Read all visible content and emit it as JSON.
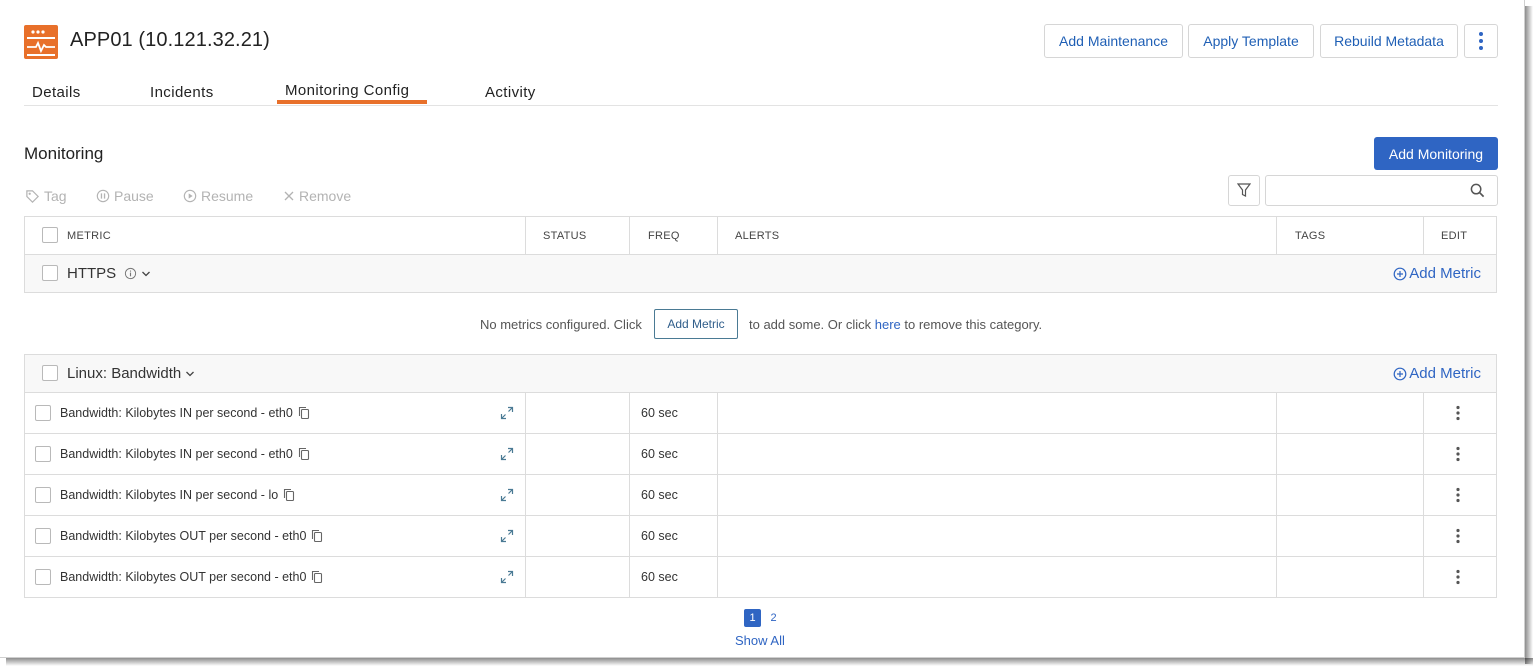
{
  "header": {
    "device_icon": "server-device-icon",
    "title": "APP01 (10.121.32.21)",
    "buttons": {
      "add_maintenance": "Add Maintenance",
      "apply_template": "Apply Template",
      "rebuild_metadata": "Rebuild Metadata",
      "more_icon": "kebab-menu-icon"
    }
  },
  "tabs": [
    {
      "label": "Details",
      "active": false
    },
    {
      "label": "Incidents",
      "active": false
    },
    {
      "label": "Monitoring Config",
      "active": true
    },
    {
      "label": "Activity",
      "active": false
    }
  ],
  "monitoring": {
    "title": "Monitoring",
    "add_button": "Add Monitoring",
    "toolbar": {
      "tag": "Tag",
      "pause": "Pause",
      "resume": "Resume",
      "remove": "Remove"
    },
    "search": {
      "value": "",
      "placeholder": ""
    },
    "columns": {
      "metric": "METRIC",
      "status": "STATUS",
      "freq": "FREQ",
      "alerts": "ALERTS",
      "tags": "TAGS",
      "edit": "EDIT"
    },
    "groups": [
      {
        "name": "HTTPS",
        "add_metric": "Add Metric",
        "empty": {
          "text_before": "No metrics configured. Click",
          "button": "Add Metric",
          "text_middle": "to add some. Or click",
          "link": "here",
          "text_after": "to remove this category."
        }
      },
      {
        "name": "Linux: Bandwidth",
        "add_metric": "Add Metric"
      }
    ],
    "rows": [
      {
        "metric": "Bandwidth: Kilobytes IN per second - eth0",
        "status": "",
        "freq": "60 sec",
        "alerts": "",
        "tags": ""
      },
      {
        "metric": "Bandwidth: Kilobytes IN per second - eth0",
        "status": "",
        "freq": "60 sec",
        "alerts": "",
        "tags": ""
      },
      {
        "metric": "Bandwidth: Kilobytes IN per second - lo",
        "status": "",
        "freq": "60 sec",
        "alerts": "",
        "tags": ""
      },
      {
        "metric": "Bandwidth: Kilobytes OUT per second - eth0",
        "status": "",
        "freq": "60 sec",
        "alerts": "",
        "tags": ""
      },
      {
        "metric": "Bandwidth: Kilobytes OUT per second - eth0",
        "status": "",
        "freq": "60 sec",
        "alerts": "",
        "tags": ""
      }
    ],
    "pagination": {
      "pages": [
        "1",
        "2"
      ],
      "current": "1",
      "show_all": "Show All"
    }
  },
  "colors": {
    "accent": "#e8702a",
    "primary": "#2f65c3",
    "link": "#2f65c3"
  }
}
